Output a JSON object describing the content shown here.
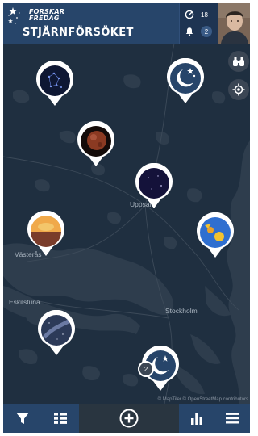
{
  "header": {
    "logo_line1": "FORSKAR",
    "logo_line2": "FREDAG",
    "title": "STJÄRNFÖRSÖKET",
    "observations_count": "18",
    "notifications_count": "2"
  },
  "map": {
    "places": {
      "uppsala": "Uppsala",
      "vasteras": "Västerås",
      "eskilstuna": "Eskilstuna",
      "stockholm": "Stockholm"
    },
    "attribution": "© MapTiler © OpenStreetMap contributors",
    "cluster_count": "2",
    "colors": {
      "land": "#1f2f40",
      "water": "#2e3d4d",
      "header": "#27456a"
    }
  }
}
